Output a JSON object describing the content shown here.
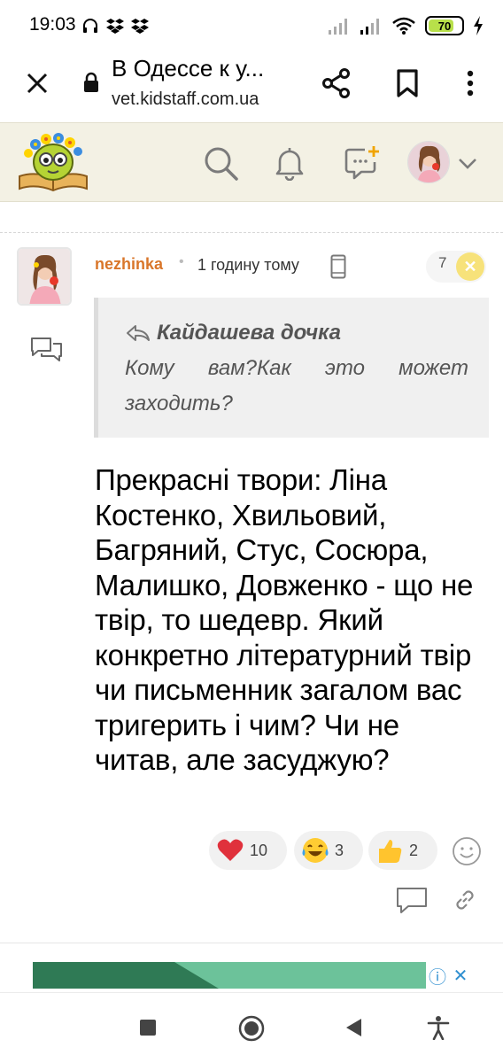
{
  "status_bar": {
    "time": "19:03",
    "battery_level": 70,
    "battery_label": "70",
    "icons_left": [
      "headphones-icon",
      "dropbox-icon",
      "dropbox-icon"
    ],
    "icons_right": [
      "signal-icon",
      "signal-icon",
      "wifi-icon",
      "battery-icon",
      "charging-icon"
    ]
  },
  "browser": {
    "page_title": "В Одессе к у...",
    "url": "vet.kidstaff.com.ua",
    "icons": [
      "close-icon",
      "lock-icon",
      "share-icon",
      "bookmark-icon",
      "more-vert-icon"
    ]
  },
  "site_header": {
    "icons": [
      "site-logo",
      "search-icon",
      "bell-icon",
      "new-message-icon",
      "user-avatar",
      "chevron-down-icon"
    ]
  },
  "post": {
    "author": "nezhinka",
    "separator": "•",
    "time": "1 годину тому",
    "counter": "7",
    "quote": {
      "author": "Кайдашева дочка",
      "text": "Кому вам?Как это может заходить?"
    },
    "body": "Прекрасні твори: Ліна Костенко, Хвильовий, Багряний, Стус, Сосюра, Малишко, Довженко - що не твір, то шедевр. Який конкретно літературний твір чи письменник загалом вас тригерить і чим? Чи не читав, але засуджую?",
    "reactions": [
      {
        "emoji": "heart-icon",
        "count": "10"
      },
      {
        "emoji": "laughing-tears-icon",
        "count": "3"
      },
      {
        "emoji": "thumbs-up-icon",
        "count": "2"
      }
    ]
  },
  "ad": {
    "info_label": "ⓘ",
    "close_label": "✕"
  },
  "colors": {
    "author": "#d9762a",
    "header_bg": "#f3f1e4",
    "quote_bg": "#f0f0f0",
    "ad_green": "#6cc29a"
  }
}
